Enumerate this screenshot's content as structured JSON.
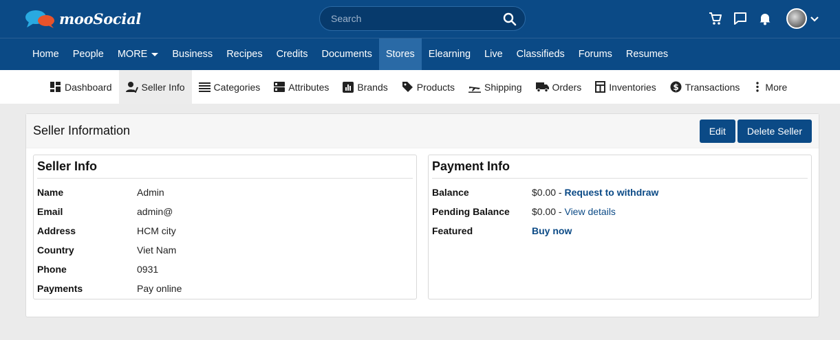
{
  "brand": {
    "name": "mooSocial"
  },
  "search": {
    "placeholder": "Search"
  },
  "main_nav": {
    "items": [
      {
        "label": "Home"
      },
      {
        "label": "People"
      },
      {
        "label": "MORE"
      },
      {
        "label": "Business"
      },
      {
        "label": "Recipes"
      },
      {
        "label": "Credits"
      },
      {
        "label": "Documents"
      },
      {
        "label": "Stores"
      },
      {
        "label": "Elearning"
      },
      {
        "label": "Live"
      },
      {
        "label": "Classifieds"
      },
      {
        "label": "Forums"
      },
      {
        "label": "Resumes"
      }
    ],
    "active": "Stores"
  },
  "sub_nav": {
    "items": [
      {
        "label": "Dashboard",
        "icon": "dashboard-icon"
      },
      {
        "label": "Seller Info",
        "icon": "seller-info-icon"
      },
      {
        "label": "Categories",
        "icon": "list-icon"
      },
      {
        "label": "Attributes",
        "icon": "attributes-icon"
      },
      {
        "label": "Brands",
        "icon": "brands-icon"
      },
      {
        "label": "Products",
        "icon": "tag-icon"
      },
      {
        "label": "Shipping",
        "icon": "plane-icon"
      },
      {
        "label": "Orders",
        "icon": "truck-icon"
      },
      {
        "label": "Inventories",
        "icon": "inventory-icon"
      },
      {
        "label": "Transactions",
        "icon": "dollar-icon"
      },
      {
        "label": "More",
        "icon": "more-vertical-icon"
      }
    ],
    "active": "Seller Info"
  },
  "panel": {
    "title": "Seller Information",
    "edit_label": "Edit",
    "delete_label": "Delete Seller"
  },
  "seller_info": {
    "title": "Seller Info",
    "rows": [
      {
        "key": "Name",
        "value": "Admin"
      },
      {
        "key": "Email",
        "value": "admin@"
      },
      {
        "key": "Address",
        "value": "HCM city"
      },
      {
        "key": "Country",
        "value": "Viet Nam"
      },
      {
        "key": "Phone",
        "value": "0931"
      },
      {
        "key": "Payments",
        "value": "Pay online"
      }
    ]
  },
  "payment_info": {
    "title": "Payment Info",
    "balance_label": "Balance",
    "balance_value": "$0.00 - ",
    "balance_link": "Request to withdraw",
    "pending_label": "Pending Balance",
    "pending_value": "$0.00 - ",
    "pending_link": "View details",
    "featured_label": "Featured",
    "featured_link": "Buy now"
  },
  "colors": {
    "brand": "#0b4a86",
    "active_nav": "#2a6aa6"
  }
}
